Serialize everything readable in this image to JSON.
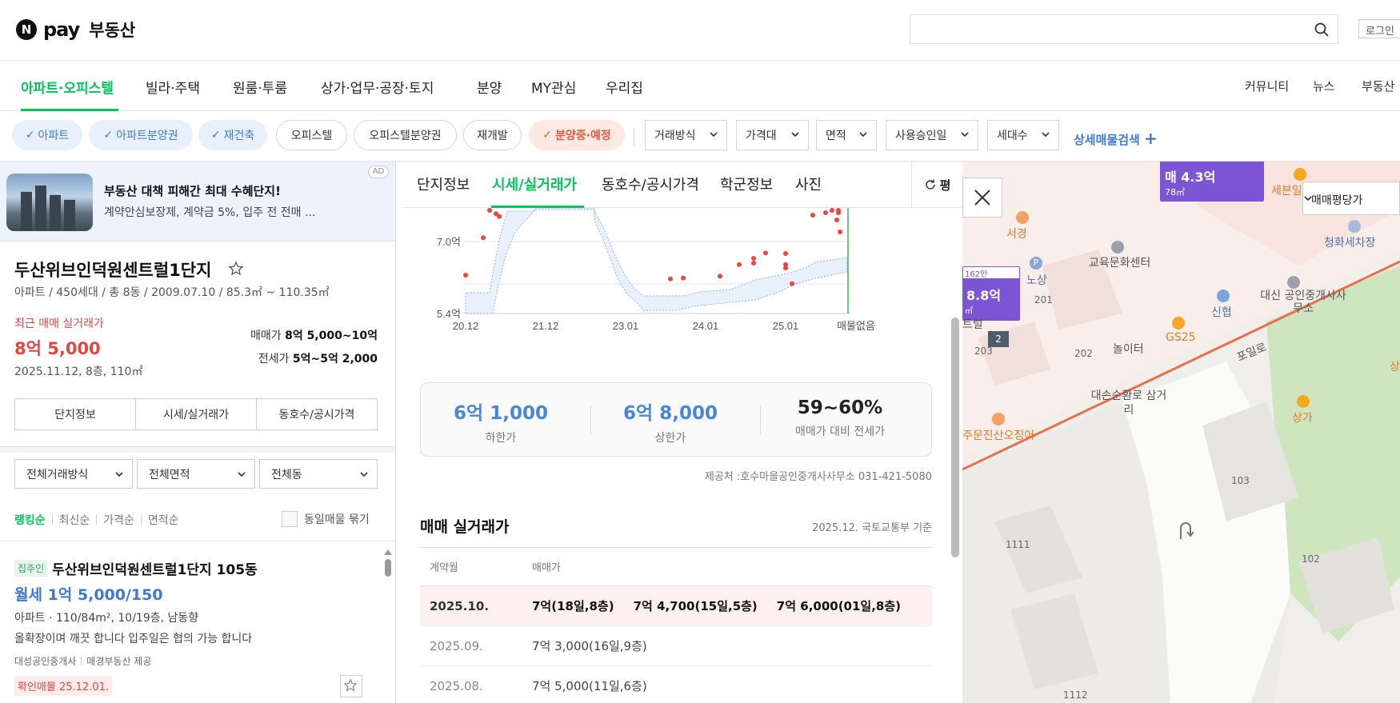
{
  "header": {
    "logo_n": "N",
    "logo_pay": "pay",
    "logo_re": "부동산",
    "search_value": "",
    "login": "로그인"
  },
  "nav": {
    "items": [
      "아파트·오피스텔",
      "빌라·주택",
      "원룸·투룸",
      "상가·업무·공장·토지",
      "분양",
      "MY관심",
      "우리집"
    ],
    "right": [
      "커뮤니티",
      "뉴스",
      "부동산"
    ]
  },
  "filters": {
    "chips": [
      "아파트",
      "아파트분양권",
      "재건축",
      "오피스텔",
      "오피스텔분양권",
      "재개발",
      "분양중·예정"
    ],
    "dropdowns": [
      "거래방식",
      "가격대",
      "면적",
      "사용승인일",
      "세대수"
    ],
    "detail_search": "상세매물검색"
  },
  "ad": {
    "title": "부동산 대책 피해간 최대 수혜단지!",
    "sub": "계약안심보장제, 계약금 5%, 입주 전 전매 ...",
    "badge": "AD"
  },
  "complex": {
    "name": "두산위브인덕원센트럴1단지",
    "meta": "아파트 / 450세대 / 총 8동 / 2009.07.10 / 85.3㎡ ~ 110.35㎡",
    "recent_label": "최근 매매 실거래가",
    "recent_price": "8억 5,000",
    "recent_date": "2025.11.12, 8층, 110㎡",
    "sale_label": "매매가",
    "sale_range": "8억 5,000~10억",
    "jeonse_label": "전세가",
    "jeonse_range": "5억~5억 2,000",
    "tabs": [
      "단지정보",
      "시세/실거래가",
      "동호수/공시가격"
    ]
  },
  "list_filters": [
    "전체거래방식",
    "전체면적",
    "전체동"
  ],
  "sort": {
    "items": [
      "랭킹순",
      "최신순",
      "가격순",
      "면적순"
    ],
    "group_label": "동일매물 묶기"
  },
  "listing": {
    "badge": "집주인",
    "name": "두산위브인덕원센트럴1단지 105동",
    "price": "월세 1억 5,000/150",
    "info": "아파트 · 110/84m², 10/19층, 남동향",
    "desc": "올확장이며 깨끗 합니다 입주일은 협의 가능 합니다",
    "agent1": "대성공인중개사",
    "agent2": "매경부동산 제공",
    "confirm": "확인매물 25.12.01."
  },
  "detail": {
    "tabs": [
      "단지정보",
      "시세/실거래가",
      "동호수/공시가격",
      "학군정보",
      "사진"
    ],
    "pyeong": "평",
    "stats": [
      {
        "value": "6억 1,000",
        "label": "하한가",
        "color": "#4a86d8"
      },
      {
        "value": "6억 8,000",
        "label": "상한가",
        "color": "#4a86d8"
      },
      {
        "value": "59~60%",
        "label": "매매가 대비 전세가",
        "color": "#222222"
      }
    ],
    "provider": "제공처 :호수마을공인중개사사무소 031-421-5080",
    "tx_title": "매매 실거래가",
    "tx_base": "2025.12. 국토교통부 기준",
    "tx_head": [
      "계약월",
      "매매가"
    ],
    "tx_rows": [
      {
        "month": "2025.10.",
        "values": [
          "7억(18일,8층)",
          "7억 4,700(15일,5층)",
          "7억 6,000(01일,8층)"
        ]
      },
      {
        "month": "2025.09.",
        "values": [
          "7억 3,000(16일,9층)"
        ]
      },
      {
        "month": "2025.08.",
        "values": [
          "7억 5,000(11일,6층)"
        ]
      }
    ]
  },
  "chart_data": {
    "type": "scatter",
    "title": "",
    "xlabel": "",
    "ylabel": "",
    "x_ticks": [
      "20.12",
      "21.12",
      "23.01",
      "24.01",
      "25.01"
    ],
    "y_ticks": [
      "7.0억",
      "5.4억"
    ],
    "ylim": [
      5.4,
      7.6
    ],
    "end_label": "매물없음",
    "series": [
      {
        "values": [
          [
            0.0,
            6.2
          ],
          [
            0.22,
            6.98
          ],
          [
            0.3,
            7.55
          ],
          [
            0.38,
            7.48
          ],
          [
            0.42,
            7.42
          ],
          [
            2.56,
            6.12
          ],
          [
            2.72,
            6.14
          ],
          [
            3.18,
            6.18
          ],
          [
            3.42,
            6.42
          ],
          [
            3.6,
            6.55
          ],
          [
            3.6,
            6.45
          ],
          [
            3.75,
            6.66
          ],
          [
            4.0,
            6.65
          ],
          [
            4.0,
            6.42
          ],
          [
            4.0,
            6.35
          ],
          [
            4.08,
            6.02
          ],
          [
            4.34,
            7.45
          ],
          [
            4.5,
            7.5
          ],
          [
            4.58,
            7.55
          ],
          [
            4.64,
            7.35
          ],
          [
            4.66,
            7.6
          ],
          [
            4.66,
            7.5
          ],
          [
            4.68,
            7.1
          ]
        ]
      }
    ]
  },
  "map": {
    "pins": [
      {
        "label": "매 4.3억",
        "sub": "78㎡"
      },
      {
        "label": "162만",
        "sub": ""
      },
      {
        "label": "8.8억",
        "sub": "㎡"
      }
    ],
    "pin_count": "2",
    "price_type": "매매평당가",
    "pois": [
      "세븐일",
      "서경",
      "청화세차장",
      "노상",
      "교육문화센터",
      "201",
      "대신 공인중개사사무소",
      "신협",
      "트럴",
      "GS25",
      "포일로",
      "203",
      "202",
      "놀이터",
      "대손순환로 삼거리",
      "상가",
      "주문진산오징어",
      "103",
      "1111",
      "102",
      "1112",
      "상"
    ]
  }
}
